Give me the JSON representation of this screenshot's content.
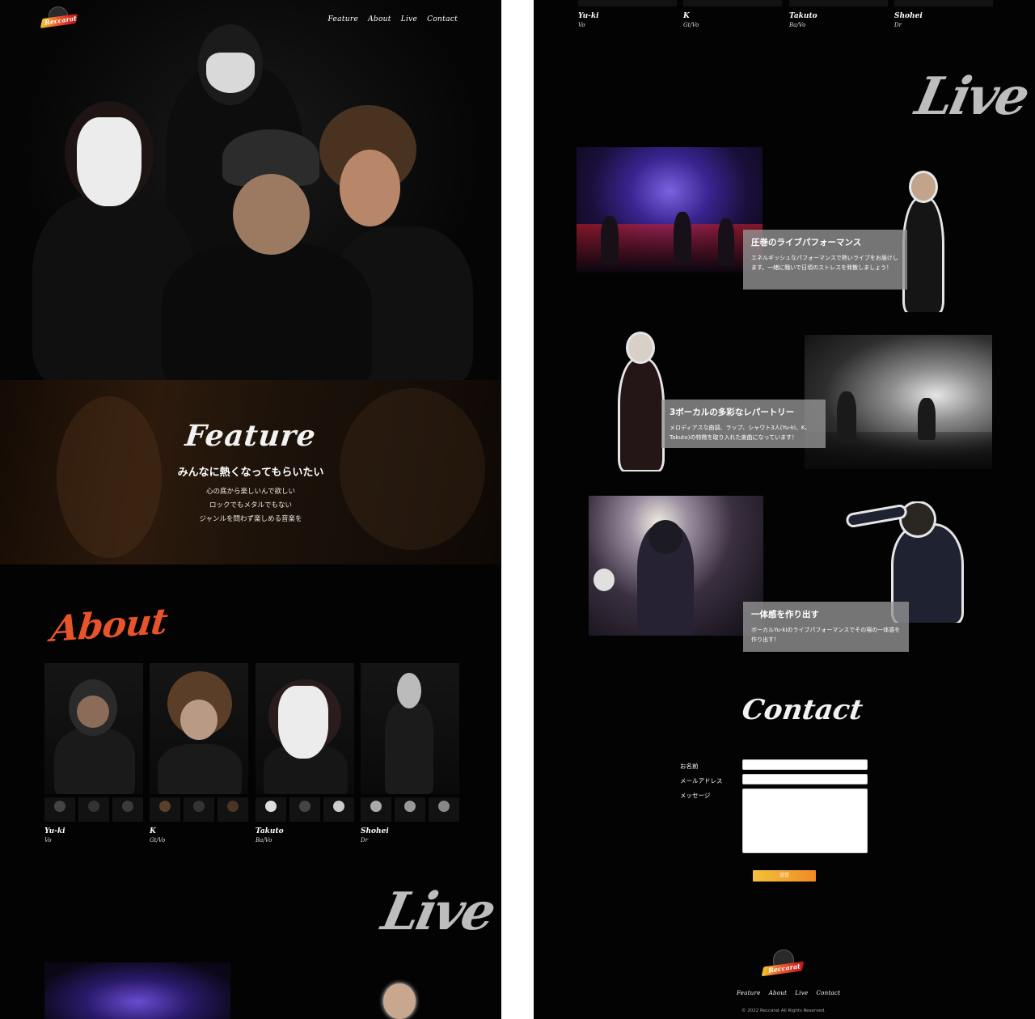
{
  "header": {
    "logo_text": "Reccarat",
    "nav": [
      "Feature",
      "About",
      "Live",
      "Contact"
    ]
  },
  "feature": {
    "title": "Feature",
    "subtitle": "みんなに熱くなってもらいたい",
    "lines": [
      "心の底から楽しいんで欲しい",
      "ロックでもメタルでもない",
      "ジャンルを問わず楽しめる音楽を"
    ]
  },
  "about": {
    "title": "About",
    "members": [
      {
        "name": "Yu-ki",
        "part": "Vo"
      },
      {
        "name": "K",
        "part": "Gt/Vo"
      },
      {
        "name": "Takuto",
        "part": "Ba/Vo"
      },
      {
        "name": "Shohei",
        "part": "Dr"
      }
    ]
  },
  "live": {
    "title": "Live",
    "cards": [
      {
        "title": "圧巻のライブパフォーマンス",
        "text": "エネルギッシュなパフォーマンスで熱いライブをお届けします。一緒に騒いで日頃のストレスを発散しましょう！"
      },
      {
        "title": "3ボーカルの多彩なレパートリー",
        "text": "メロディアスな曲調、ラップ、シャウト3人(Yu-ki、K、Takuto)の特徴を取り入れた楽曲になっています！"
      },
      {
        "title": "一体感を作り出す",
        "text": "ボーカルYu-kiのライブパフォーマンスでその場の一体感を作り出す！"
      }
    ]
  },
  "contact": {
    "title": "Contact",
    "labels": {
      "name": "お名前",
      "email": "メールアドレス",
      "message": "メッセージ"
    },
    "submit": "送信"
  },
  "footer": {
    "nav": [
      "Feature",
      "About",
      "Live",
      "Contact"
    ],
    "copyright": "© 2022 Reccarat All Rights Reserved."
  },
  "colors": {
    "accent": "#e8542a",
    "submit_start": "#f3c23a",
    "submit_end": "#f08a24",
    "background": "#030303"
  },
  "icons": [
    "logo-icon"
  ]
}
